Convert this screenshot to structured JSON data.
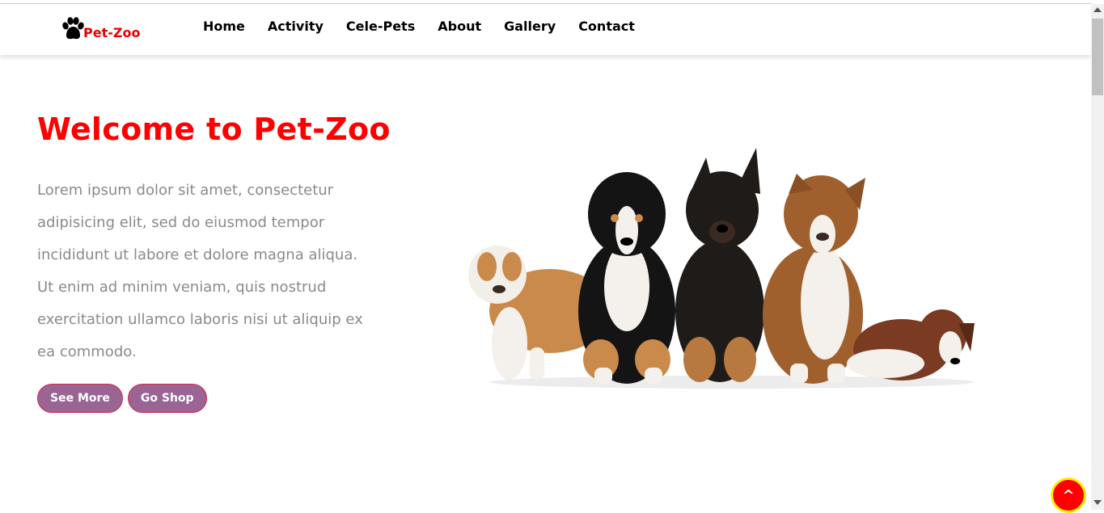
{
  "header": {
    "logo_text": "Pet-Zoo",
    "logo_icon": "paw-icon",
    "nav": [
      "Home",
      "Activity",
      "Cele-Pets",
      "About",
      "Gallery",
      "Contact"
    ]
  },
  "hero": {
    "title": "Welcome to Pet-Zoo",
    "text": "Lorem ipsum dolor sit amet, consectetur adipisicing elit, sed do eiusmod tempor incididunt ut labore et dolore magna aliqua. Ut enim ad minim veniam, quis nostrud exercitation ullamco laboris nisi ut aliquip ex ea commodo.",
    "buttons": [
      "See More",
      "Go Shop"
    ],
    "image": "puppies-image"
  },
  "scroll_top_label": "^",
  "colors": {
    "accent": "#ff0000",
    "button_bg": "#9a6495",
    "button_border": "#cf2c4a",
    "text_gray": "#8a8a8a",
    "scroll_top_border": "#ffee00"
  }
}
